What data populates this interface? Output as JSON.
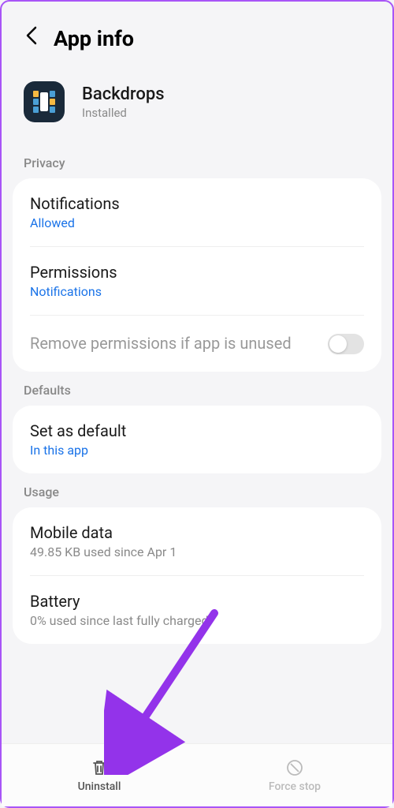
{
  "header": {
    "title": "App info"
  },
  "app": {
    "name": "Backdrops",
    "status": "Installed"
  },
  "sections": {
    "privacy": {
      "label": "Privacy",
      "notifications": {
        "title": "Notifications",
        "value": "Allowed"
      },
      "permissions": {
        "title": "Permissions",
        "value": "Notifications"
      },
      "remove_unused": {
        "title": "Remove permissions if app is unused"
      }
    },
    "defaults": {
      "label": "Defaults",
      "set_default": {
        "title": "Set as default",
        "value": "In this app"
      }
    },
    "usage": {
      "label": "Usage",
      "mobile_data": {
        "title": "Mobile data",
        "value": "49.85 KB used since Apr 1"
      },
      "battery": {
        "title": "Battery",
        "value": "0% used since last fully charged"
      }
    }
  },
  "bottom": {
    "uninstall": "Uninstall",
    "force_stop": "Force stop"
  }
}
